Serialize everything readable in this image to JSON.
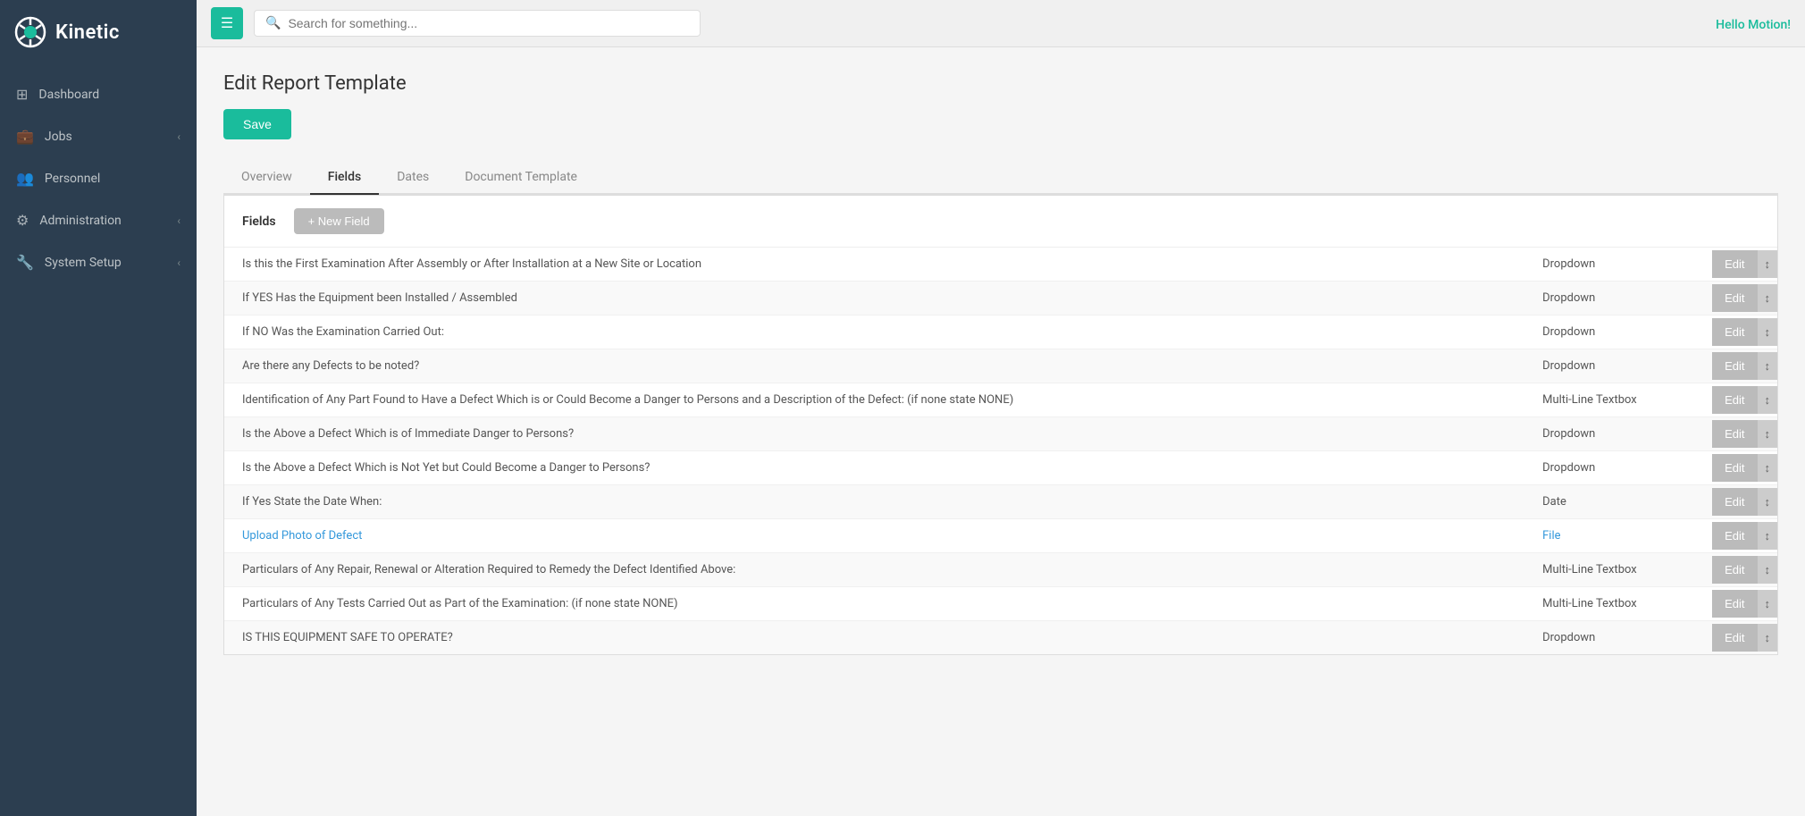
{
  "app": {
    "name": "Kinetic"
  },
  "topbar": {
    "search_placeholder": "Search for something...",
    "greeting": "Hello Motion!"
  },
  "sidebar": {
    "items": [
      {
        "id": "dashboard",
        "label": "Dashboard",
        "icon": "grid",
        "chevron": false
      },
      {
        "id": "jobs",
        "label": "Jobs",
        "icon": "briefcase",
        "chevron": true
      },
      {
        "id": "personnel",
        "label": "Personnel",
        "icon": "users",
        "chevron": false
      },
      {
        "id": "administration",
        "label": "Administration",
        "icon": "settings",
        "chevron": true
      },
      {
        "id": "system-setup",
        "label": "System Setup",
        "icon": "wrench",
        "chevron": true
      }
    ]
  },
  "page": {
    "title": "Edit Report Template",
    "save_label": "Save"
  },
  "tabs": [
    {
      "id": "overview",
      "label": "Overview",
      "active": false
    },
    {
      "id": "fields",
      "label": "Fields",
      "active": true
    },
    {
      "id": "dates",
      "label": "Dates",
      "active": false
    },
    {
      "id": "document-template",
      "label": "Document Template",
      "active": false
    }
  ],
  "fields_section": {
    "label": "Fields",
    "new_field_label": "+ New Field"
  },
  "fields": [
    {
      "name": "Is this the First Examination After Assembly or After Installation at a New Site or Location",
      "type": "Dropdown",
      "blue": false
    },
    {
      "name": "If YES Has the Equipment been Installed / Assembled",
      "type": "Dropdown",
      "blue": false
    },
    {
      "name": "If NO Was the Examination Carried Out:",
      "type": "Dropdown",
      "blue": false
    },
    {
      "name": "Are there any Defects to be noted?",
      "type": "Dropdown",
      "blue": false
    },
    {
      "name": "Identification of Any Part Found to Have a Defect Which is or Could Become a Danger to Persons and a Description of the Defect: (if none state NONE)",
      "type": "Multi-Line Textbox",
      "blue": false
    },
    {
      "name": "Is the Above a Defect Which is of Immediate Danger to Persons?",
      "type": "Dropdown",
      "blue": false
    },
    {
      "name": "Is the Above a Defect Which is Not Yet but Could Become a Danger to Persons?",
      "type": "Dropdown",
      "blue": false
    },
    {
      "name": "If Yes State the Date When:",
      "type": "Date",
      "blue": false
    },
    {
      "name": "Upload Photo of Defect",
      "type": "File",
      "blue": true
    },
    {
      "name": "Particulars of Any Repair, Renewal or Alteration Required to Remedy the Defect Identified Above:",
      "type": "Multi-Line Textbox",
      "blue": false
    },
    {
      "name": "Particulars of Any Tests Carried Out as Part of the Examination: (if none state NONE)",
      "type": "Multi-Line Textbox",
      "blue": false
    },
    {
      "name": "IS THIS EQUIPMENT SAFE TO OPERATE?",
      "type": "Dropdown",
      "blue": false
    }
  ],
  "buttons": {
    "edit_label": "Edit",
    "sort_icon": "↕"
  }
}
